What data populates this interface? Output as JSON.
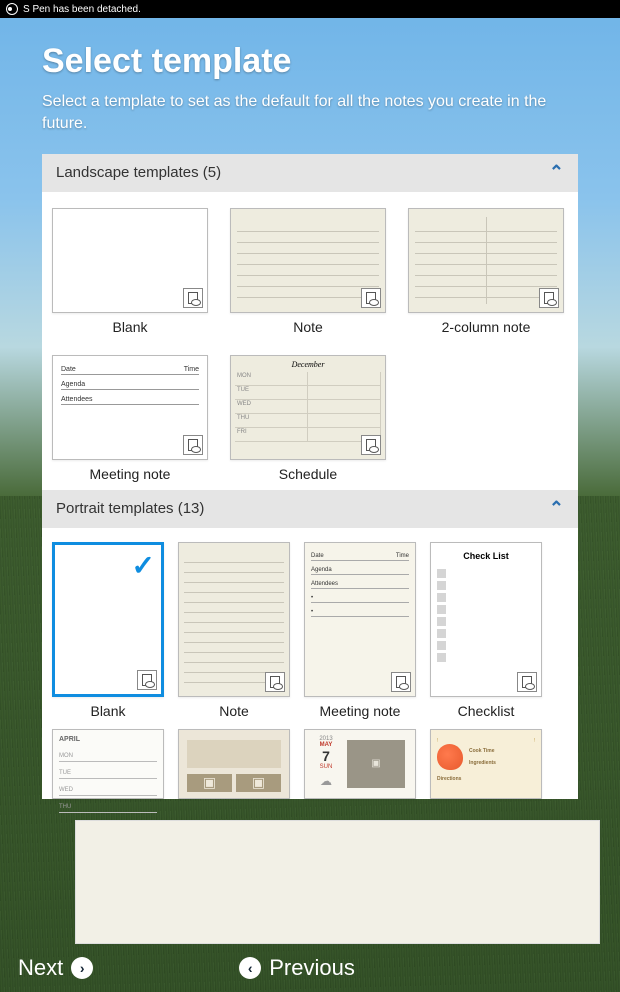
{
  "statusbar": {
    "message": "S Pen has been detached."
  },
  "header": {
    "title": "Select template",
    "subtitle": "Select a template to set as the default for all the notes you create in the future."
  },
  "sections": {
    "landscape": {
      "title": "Landscape templates (5)",
      "items": [
        {
          "label": "Blank"
        },
        {
          "label": "Note"
        },
        {
          "label": "2-column note"
        },
        {
          "label": "Meeting note",
          "fields": {
            "date": "Date",
            "time": "Time",
            "agenda": "Agenda",
            "attendees": "Attendees"
          }
        },
        {
          "label": "Schedule",
          "month": "December",
          "days": [
            "MON",
            "TUE",
            "WED",
            "THU",
            "FRI"
          ]
        }
      ]
    },
    "portrait": {
      "title": "Portrait templates (13)",
      "selected": 0,
      "items": [
        {
          "label": "Blank"
        },
        {
          "label": "Note"
        },
        {
          "label": "Meeting note",
          "fields": {
            "date": "Date",
            "time": "Time",
            "agenda": "Agenda",
            "attendees": "Attendees"
          }
        },
        {
          "label": "Checklist",
          "heading": "Check List"
        },
        {
          "label": "",
          "month": "APRIL",
          "days": [
            "MON",
            "TUE",
            "WED",
            "THU"
          ]
        },
        {
          "label": ""
        },
        {
          "label": "",
          "year": "2013",
          "month": "MAY",
          "day": "7",
          "dow": "SUN"
        },
        {
          "label": "",
          "cooktime": "Cook Time",
          "ingredients": "Ingredients",
          "directions": "Directions"
        }
      ]
    }
  },
  "footer": {
    "next": "Next",
    "previous": "Previous"
  }
}
